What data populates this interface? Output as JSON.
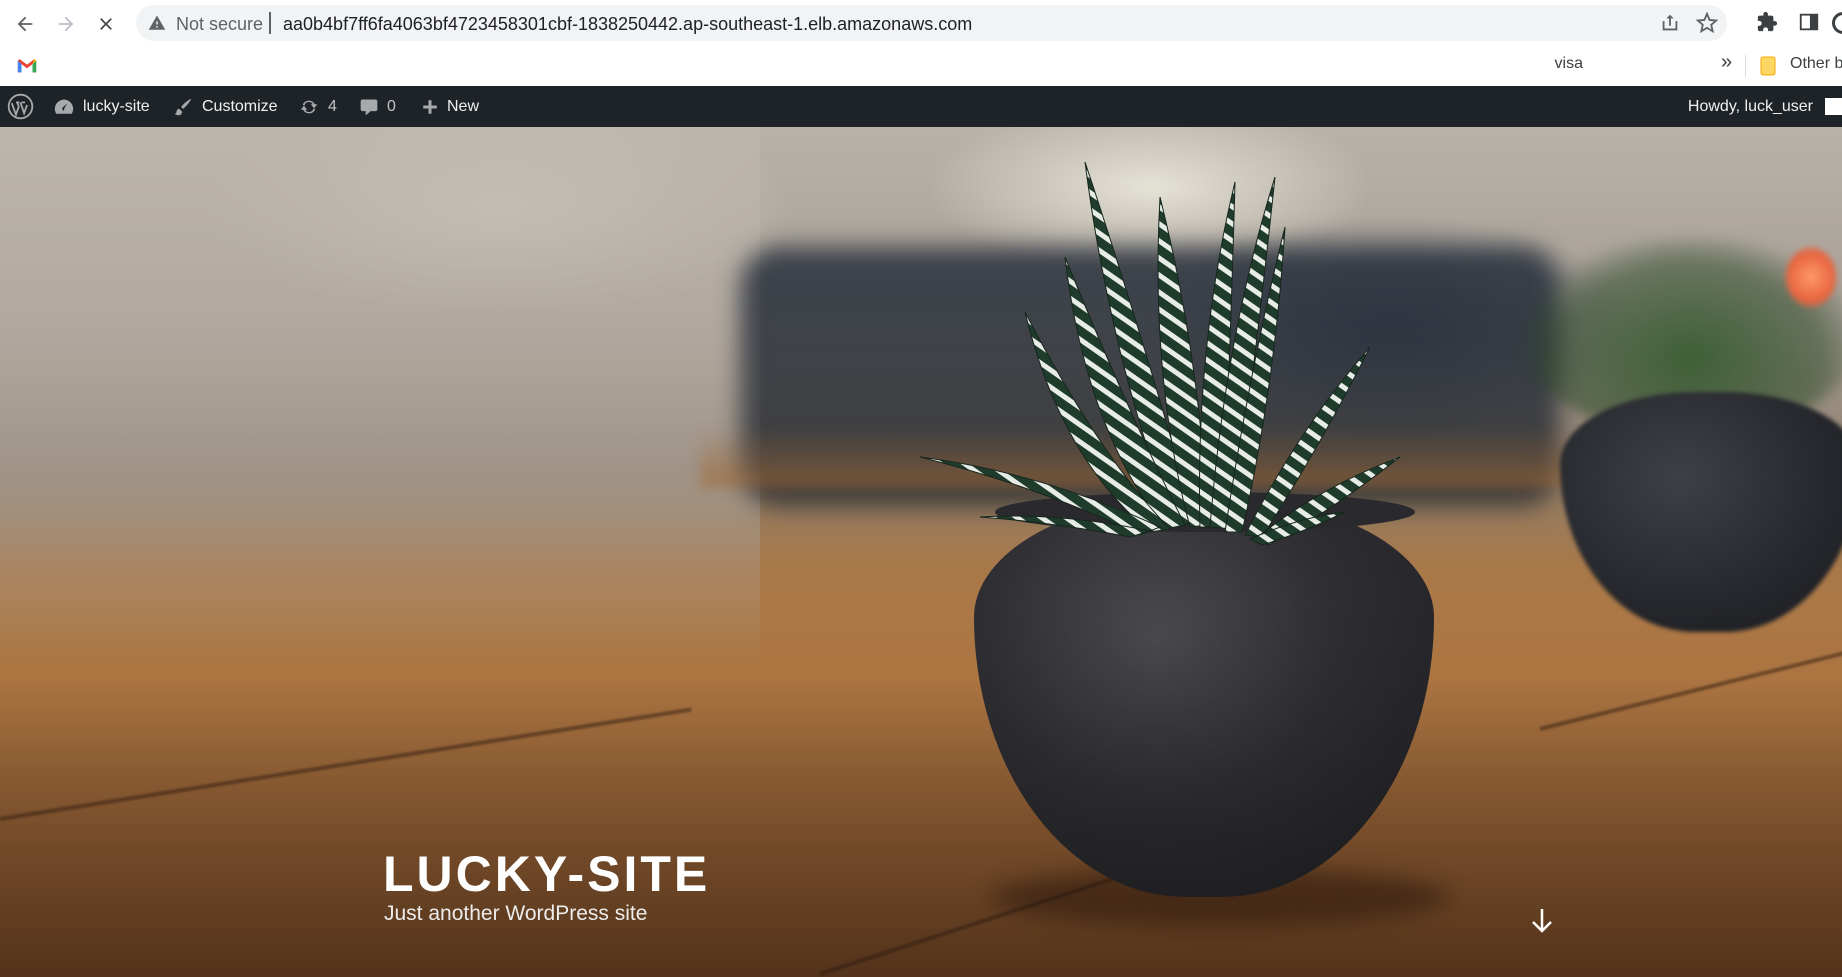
{
  "browser": {
    "security_label": "Not secure",
    "url": "aa0b4bf7ff6fa4063bf4723458301cbf-1838250442.ap-southeast-1.elb.amazonaws.com",
    "bookmarks": {
      "visible_item": "visa",
      "other_label": "Other bookmarks"
    }
  },
  "admin_bar": {
    "site_name": "lucky-site",
    "customize": "Customize",
    "updates_count": "4",
    "comments_count": "0",
    "new_label": "New",
    "howdy": "Howdy, luck_user"
  },
  "hero": {
    "site_title": "LUCKY-SITE",
    "tagline": "Just another WordPress site"
  },
  "colors": {
    "admin_bar_bg": "#1d2327",
    "omnibox_bg": "#f1f3f4",
    "title_color": "#ffffff"
  }
}
